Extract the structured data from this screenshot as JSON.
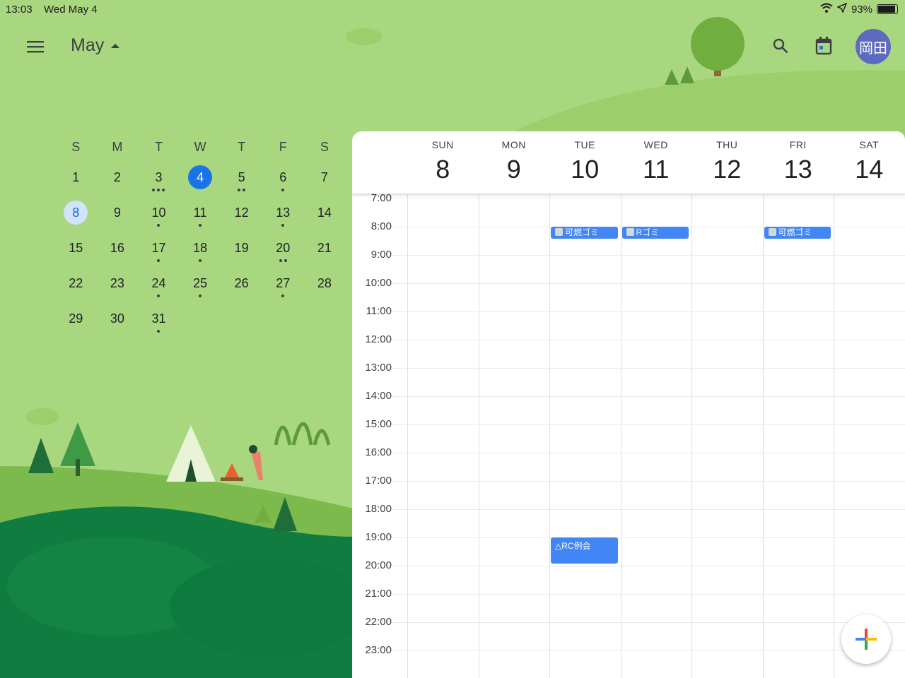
{
  "status_bar": {
    "time": "13:03",
    "date": "Wed May 4",
    "battery": "93%"
  },
  "app_bar": {
    "menu_icon": "menu-icon",
    "month_label": "May",
    "search_icon": "search-icon",
    "today_icon": "calendar-today-icon",
    "avatar_text": "岡田"
  },
  "mini_calendar": {
    "weekdays": [
      "S",
      "M",
      "T",
      "W",
      "T",
      "F",
      "S"
    ],
    "days": [
      {
        "n": "1",
        "dots": 0
      },
      {
        "n": "2",
        "dots": 0
      },
      {
        "n": "3",
        "dots": 3
      },
      {
        "n": "4",
        "dots": 0,
        "today": true
      },
      {
        "n": "5",
        "dots": 2
      },
      {
        "n": "6",
        "dots": 1
      },
      {
        "n": "7",
        "dots": 0
      },
      {
        "n": "8",
        "dots": 0,
        "selected": true
      },
      {
        "n": "9",
        "dots": 0
      },
      {
        "n": "10",
        "dots": 1
      },
      {
        "n": "11",
        "dots": 1
      },
      {
        "n": "12",
        "dots": 0
      },
      {
        "n": "13",
        "dots": 1
      },
      {
        "n": "14",
        "dots": 0
      },
      {
        "n": "15",
        "dots": 0
      },
      {
        "n": "16",
        "dots": 0
      },
      {
        "n": "17",
        "dots": 1
      },
      {
        "n": "18",
        "dots": 1
      },
      {
        "n": "19",
        "dots": 0
      },
      {
        "n": "20",
        "dots": 2
      },
      {
        "n": "21",
        "dots": 0
      },
      {
        "n": "22",
        "dots": 0
      },
      {
        "n": "23",
        "dots": 0
      },
      {
        "n": "24",
        "dots": 1
      },
      {
        "n": "25",
        "dots": 1
      },
      {
        "n": "26",
        "dots": 0
      },
      {
        "n": "27",
        "dots": 1
      },
      {
        "n": "28",
        "dots": 0
      },
      {
        "n": "29",
        "dots": 0
      },
      {
        "n": "30",
        "dots": 0
      },
      {
        "n": "31",
        "dots": 1
      }
    ]
  },
  "week_view": {
    "days": [
      {
        "name": "SUN",
        "date": "8"
      },
      {
        "name": "MON",
        "date": "9"
      },
      {
        "name": "TUE",
        "date": "10"
      },
      {
        "name": "WED",
        "date": "11"
      },
      {
        "name": "THU",
        "date": "12"
      },
      {
        "name": "FRI",
        "date": "13"
      },
      {
        "name": "SAT",
        "date": "14"
      }
    ],
    "hours": [
      "7:00",
      "8:00",
      "9:00",
      "10:00",
      "11:00",
      "12:00",
      "13:00",
      "14:00",
      "15:00",
      "16:00",
      "17:00",
      "18:00",
      "19:00",
      "20:00",
      "21:00",
      "22:00",
      "23:00"
    ],
    "events": [
      {
        "day": 2,
        "title": "可燃ゴミ",
        "start": "8:00",
        "end": "8:30",
        "icon": "trash-icon"
      },
      {
        "day": 3,
        "title": "Rゴミ",
        "start": "8:00",
        "end": "8:30",
        "icon": "trash-icon"
      },
      {
        "day": 5,
        "title": "可燃ゴミ",
        "start": "8:00",
        "end": "8:30",
        "icon": "trash-icon"
      },
      {
        "day": 2,
        "title": "△RC例会",
        "start": "19:00",
        "end": "20:00"
      }
    ]
  },
  "fab": {
    "icon": "plus-icon"
  },
  "colors": {
    "accent": "#1a73e8",
    "event": "#4285f4",
    "background": "#a9d780"
  }
}
